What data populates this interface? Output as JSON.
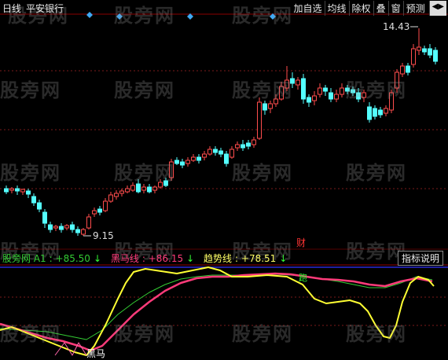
{
  "header": {
    "period": "日线",
    "security": "平安银行"
  },
  "toolbar": {
    "items": [
      "加自选",
      "均线",
      "除权",
      "叠",
      "窗",
      "预测"
    ],
    "nav_icon": "left-right-arrows-icon"
  },
  "price_panel": {
    "high_label": "14.43",
    "low_label": "9.15",
    "marker_label": "财",
    "marker_color": "#ff3333",
    "diamond_color": "#3fa9f5",
    "up_color": "#ff4d4d",
    "down_color": "#54ffff"
  },
  "indicator": {
    "name": "股旁网 A1",
    "a1_value": "+85.50",
    "a1_arrow": "↓",
    "heima_label": "黑马线",
    "heima_value": "+86.15",
    "heima_arrow": "↓",
    "trend_label": "趋势线",
    "trend_value": "+78.51",
    "trend_arrow": "↓",
    "help_label": "指标说明",
    "heima_text": "黑马",
    "pao_text": "跑",
    "colors": {
      "trend": "#ffff33",
      "heima": "#ff3b7a",
      "a1": "#33cc33",
      "top_line": "#3333ff"
    }
  },
  "watermark": "股旁网"
}
